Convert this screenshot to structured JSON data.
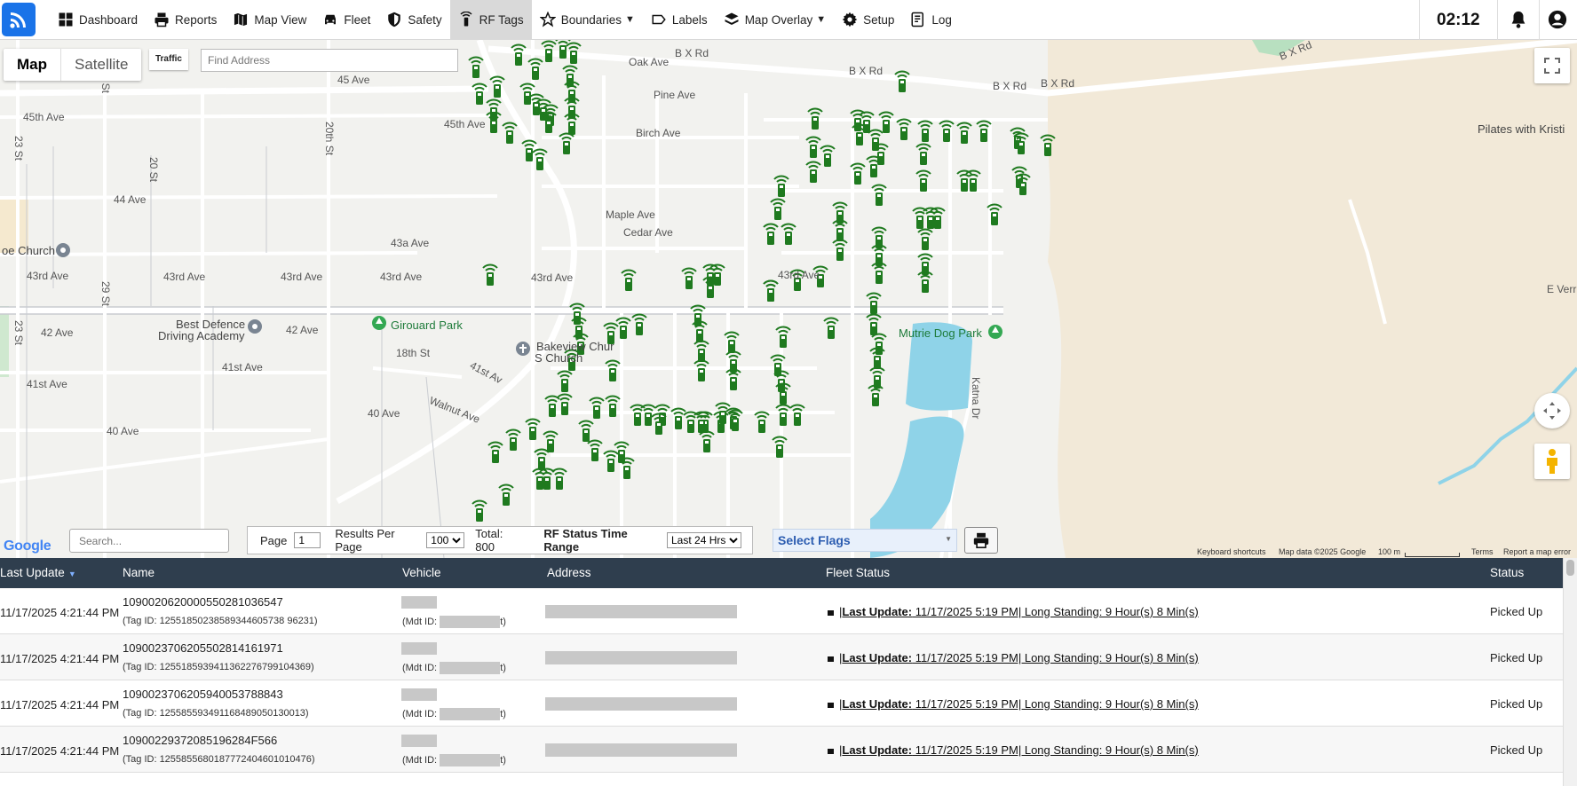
{
  "nav": {
    "items": [
      {
        "label": "Dashboard",
        "icon": "dashboard-icon"
      },
      {
        "label": "Reports",
        "icon": "printer-icon"
      },
      {
        "label": "Map View",
        "icon": "map-icon"
      },
      {
        "label": "Fleet",
        "icon": "car-icon"
      },
      {
        "label": "Safety",
        "icon": "shield-icon"
      },
      {
        "label": "RF Tags",
        "icon": "rf-tag-icon"
      },
      {
        "label": "Boundaries",
        "icon": "star-icon",
        "dropdown": "▼"
      },
      {
        "label": "Labels",
        "icon": "label-icon"
      },
      {
        "label": "Map Overlay",
        "icon": "layers-icon",
        "dropdown": "▼"
      },
      {
        "label": "Setup",
        "icon": "gear-icon"
      },
      {
        "label": "Log",
        "icon": "log-icon"
      }
    ],
    "active": "RF Tags",
    "clock": "02:12"
  },
  "map": {
    "type_map": "Map",
    "type_satellite": "Satellite",
    "traffic": "Traffic",
    "find_placeholder": "Find Address",
    "labels": {
      "oak": "Oak Ave",
      "pine": "Pine Ave",
      "birch": "Birch Ave",
      "maple": "Maple Ave",
      "cedar": "Cedar Ave",
      "ave45": "45 Ave",
      "ave45th": "45th Ave",
      "ave45th2": "45th Ave",
      "ave44": "44 Ave",
      "ave43a": "43a Ave",
      "ave43rd_1": "43rd Ave",
      "ave43rd_2": "43rd Ave",
      "ave43rd_3": "43rd Ave",
      "ave43rd_4": "43rd Ave",
      "ave43rd_5": "43rd Ave",
      "ave42": "42 Ave",
      "ave42b": "42 Ave",
      "ave41st": "41st Ave",
      "ave41st2": "41st Ave",
      "ave40": "40 Ave",
      "ave40b": "40 Ave",
      "st18": "18th St",
      "bxrd1": "B X Rd",
      "bxrd2": "B X Rd",
      "bxrd3": "B X Rd",
      "bxrd4": "B X Rd",
      "bxrd5": "B X Rd",
      "church": "oe Church",
      "girouard": "Girouard Park",
      "bestdef1": "Best Defence",
      "bestdef2": "Driving Academy",
      "bakeview1": "Bakeview Chur",
      "bakeview2": "S      Church",
      "mutrie": "Mutrie Dog Park",
      "pilates": "Pilates with Kristi",
      "walnut": "Walnut Ave",
      "everr": "E Verr",
      "ave41": "41st Av",
      "st23": "23 St",
      "st29": "29 St",
      "st20": "20th St",
      "st20b": "20 St",
      "st23b": "23 St",
      "st29b": "29 St",
      "ave43rd_6": "43rd Ave",
      "katnaDr": "Katna Dr"
    },
    "google": "Google",
    "keyboard_shortcuts": "Keyboard shortcuts",
    "map_data": "Map data ©2025 Google",
    "scale": "100 m",
    "terms": "Terms",
    "report_error": "Report a map error",
    "tag_color": "#1f7a1f",
    "water_color": "#8fd3e8",
    "park_color": "#f2e9d8"
  },
  "controls": {
    "search_placeholder": "Search...",
    "page_label": "Page",
    "page_value": "1",
    "per_page_label": "Results Per Page",
    "per_page_value": "100",
    "total": "Total: 800",
    "rf_status_label": "RF Status Time Range",
    "time_range": "Last 24 Hrs",
    "select_flags": "Select Flags"
  },
  "table": {
    "headers": {
      "last_update": "Last Update",
      "name": "Name",
      "vehicle": "Vehicle",
      "address": "Address",
      "fleet_status": "Fleet Status",
      "status": "Status"
    },
    "rows": [
      {
        "last_update": "11/17/2025 4:21:44 PM",
        "name": "109002062000055028103654​7",
        "tag": "(Tag ID: 12551850238589344605738 96231)",
        "mdt_prefix": "(Mdt ID:",
        "mdt_suffix": "t)",
        "fleet_prefix": "Last Update:",
        "fleet_rest": " 11/17/2025 5:19 PM| Long Standing: 9 Hour(s) 8 Min(s)",
        "status": "Picked Up"
      },
      {
        "last_update": "11/17/2025 4:21:44 PM",
        "name": "109002370620550281416197​1",
        "tag": "(Tag ID: 125518593941136227679910​4369)",
        "mdt_prefix": "(Mdt ID:",
        "mdt_suffix": "t)",
        "fleet_prefix": "Last Update:",
        "fleet_rest": " 11/17/2025 5:19 PM| Long Standing: 9 Hour(s) 8 Min(s)",
        "status": "Picked Up"
      },
      {
        "last_update": "11/17/2025 4:21:44 PM",
        "name": "109002370620594005378884​3",
        "tag": "(Tag ID: 125585593491168489050130​013)",
        "mdt_prefix": "(Mdt ID:",
        "mdt_suffix": "t)",
        "fleet_prefix": "Last Update:",
        "fleet_rest": " 11/17/2025 5:19 PM| Long Standing: 9 Hour(s) 8 Min(s)",
        "status": "Picked Up"
      },
      {
        "last_update": "11/17/2025 4:21:44 PM",
        "name": "10900229372085196284F566",
        "tag": "(Tag ID: 125585568018777240460101​0476)",
        "mdt_prefix": "(Mdt ID:",
        "mdt_suffix": "t)",
        "fleet_prefix": "Last Update:",
        "fleet_rest": " 11/17/2025 5:19 PM| Long Standing: 9 Hour(s) 8 Min(s)",
        "status": "Picked Up"
      }
    ]
  }
}
